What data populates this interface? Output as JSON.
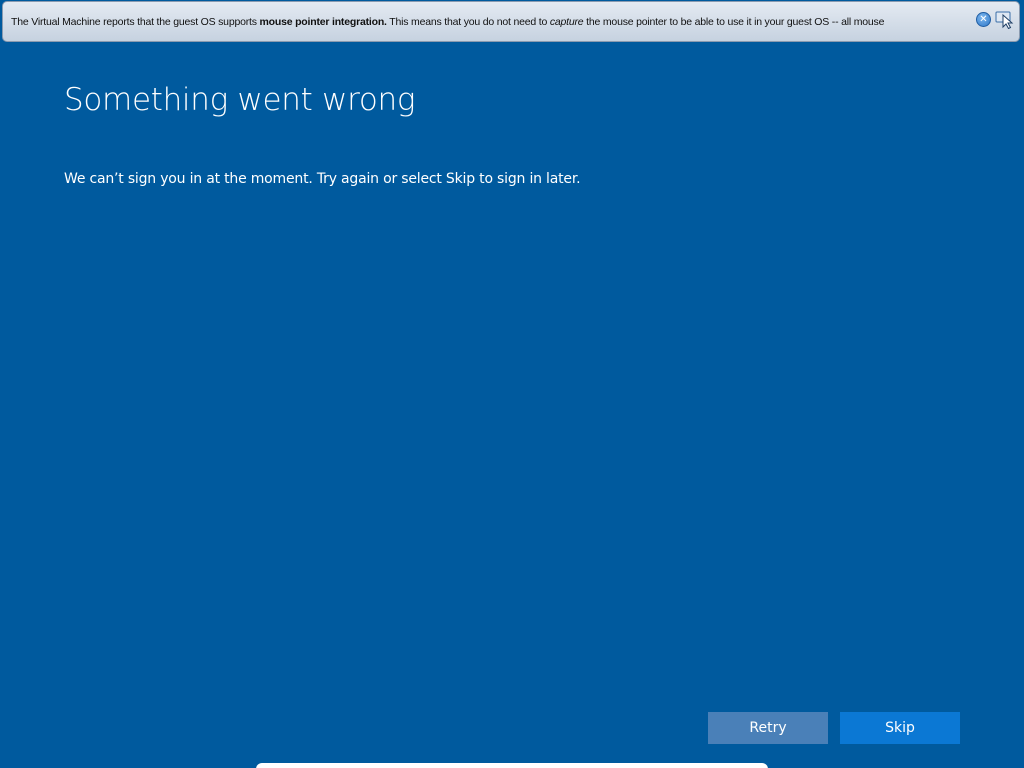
{
  "vm_notification": {
    "text_part1": "The Virtual Machine reports that the guest OS supports ",
    "text_bold": "mouse pointer integration.",
    "text_part2": " This means that you do not need to ",
    "text_italic": "capture",
    "text_part3": " the mouse pointer to be able to use it in your guest OS -- all mouse",
    "close_icon": "close-icon",
    "pointer_icon": "mouse-pointer-integration-icon"
  },
  "page": {
    "title": "Something went wrong",
    "message": "We can’t sign you in at the moment. Try again or select Skip to sign in later."
  },
  "buttons": {
    "retry_label": "Retry",
    "skip_label": "Skip"
  },
  "colors": {
    "background": "#005a9e",
    "retry_button": "#4a80b8",
    "skip_button": "#0b78d4"
  }
}
